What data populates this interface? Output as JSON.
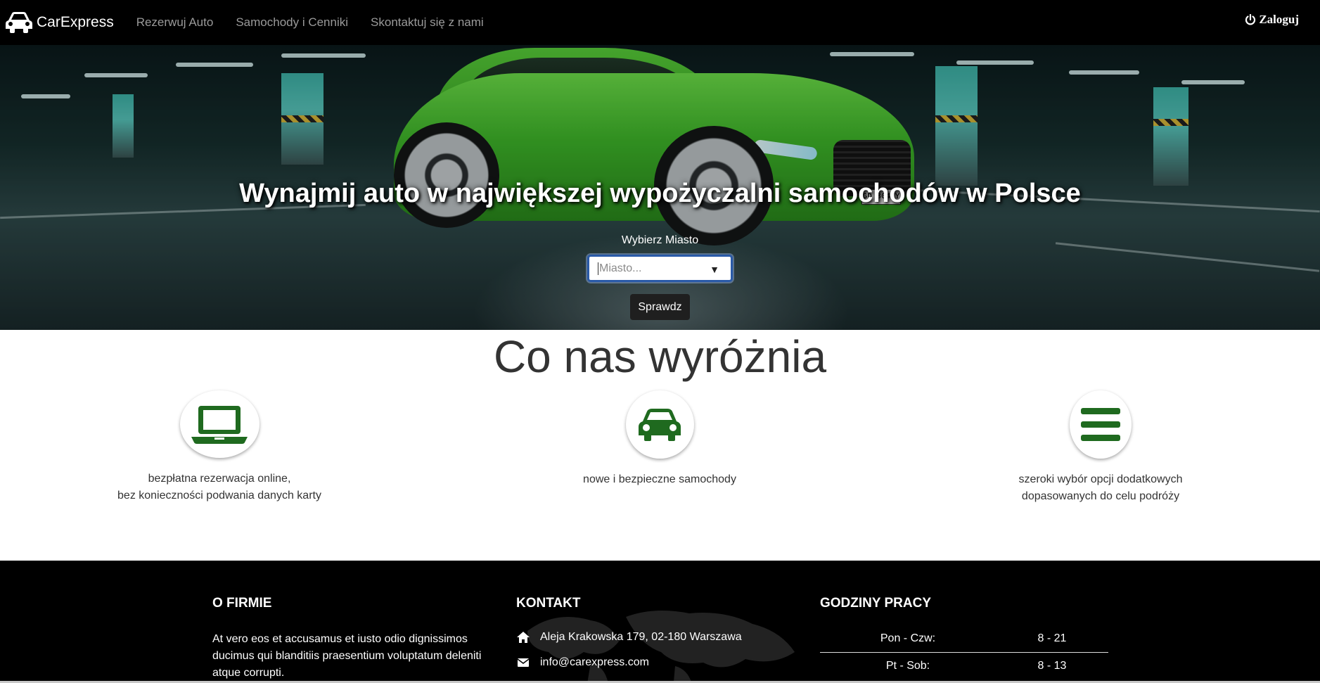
{
  "nav": {
    "brand": "CarExpress",
    "links": [
      "Rezerwuj Auto",
      "Samochody i Cenniki",
      "Skontaktuj się z nami"
    ],
    "login": "Zaloguj"
  },
  "hero": {
    "title": "Wynajmij auto w największej wypożyczalni samochodów w Polsce",
    "city_label": "Wybierz Miasto",
    "city_placeholder": "Miasto...",
    "check_button": "Sprawdz",
    "plate_text": "GD 804XY"
  },
  "features": {
    "title": "Co nas wyróżnia",
    "items": [
      {
        "icon": "laptop-icon",
        "lines": [
          "bezpłatna rezerwacja online,",
          "bez konieczności podwania danych karty"
        ]
      },
      {
        "icon": "car-icon",
        "lines": [
          "nowe i bezpieczne samochody"
        ]
      },
      {
        "icon": "bars-icon",
        "lines": [
          "szeroki wybór opcji dodatkowych",
          "dopasowanych do celu podróży"
        ]
      }
    ]
  },
  "footer": {
    "about": {
      "title": "O FIRMIE",
      "text": "At vero eos et accusamus et iusto odio dignissimos ducimus qui blanditiis praesentium voluptatum deleniti atque corrupti."
    },
    "contact": {
      "title": "KONTAKT",
      "address": "Aleja Krakowska 179, 02-180 Warszawa",
      "email": "info@carexpress.com"
    },
    "hours": {
      "title": "GODZINY PRACY",
      "rows": [
        {
          "day": "Pon - Czw:",
          "time": "8 - 21"
        },
        {
          "day": "Pt - Sob:",
          "time": "8 - 13"
        }
      ]
    }
  },
  "colors": {
    "navbar_bg": "#000000",
    "accent_green": "#1f6a1f",
    "nav_link": "#9a9a9a",
    "footer_bg": "#000000"
  }
}
